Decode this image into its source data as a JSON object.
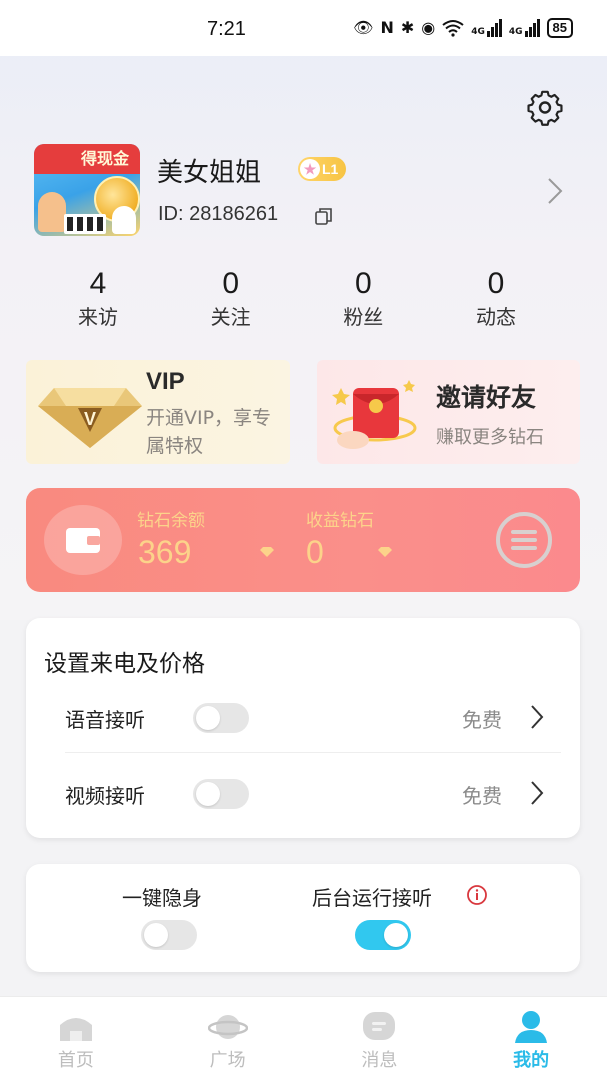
{
  "status_bar": {
    "time": "7:21",
    "network1": "4G",
    "network2": "4G",
    "battery": "85"
  },
  "profile": {
    "nickname": "美女姐姐",
    "level": "L1",
    "id_text": "ID: 28186261",
    "avatar_caption": "得现金"
  },
  "stats": [
    {
      "value": "4",
      "label": "来访"
    },
    {
      "value": "0",
      "label": "关注"
    },
    {
      "value": "0",
      "label": "粉丝"
    },
    {
      "value": "0",
      "label": "动态"
    }
  ],
  "vip_card": {
    "title": "VIP",
    "description": "开通VIP，享专属特权"
  },
  "invite_card": {
    "title": "邀请好友",
    "description": "赚取更多钻石"
  },
  "wallet": {
    "balance_label": "钻石余额",
    "balance_value": "369",
    "earnings_label": "收益钻石",
    "earnings_value": "0"
  },
  "call_settings": {
    "title": "设置来电及价格",
    "rows": [
      {
        "label": "语音接听",
        "price": "免费",
        "enabled": false
      },
      {
        "label": "视频接听",
        "price": "免费",
        "enabled": false
      }
    ]
  },
  "privacy": {
    "invisible_label": "一键隐身",
    "invisible_enabled": false,
    "background_label": "后台运行接听",
    "background_enabled": true
  },
  "tabbar": {
    "tabs": [
      {
        "label": "首页",
        "active": false
      },
      {
        "label": "广场",
        "active": false
      },
      {
        "label": "消息",
        "active": false
      },
      {
        "label": "我的",
        "active": true
      }
    ]
  },
  "colors": {
    "accent": "#31c8ef",
    "wallet_gradient_start": "#f98a7f",
    "wallet_text": "#fcd38a",
    "active_tab": "#2bbbe8"
  }
}
